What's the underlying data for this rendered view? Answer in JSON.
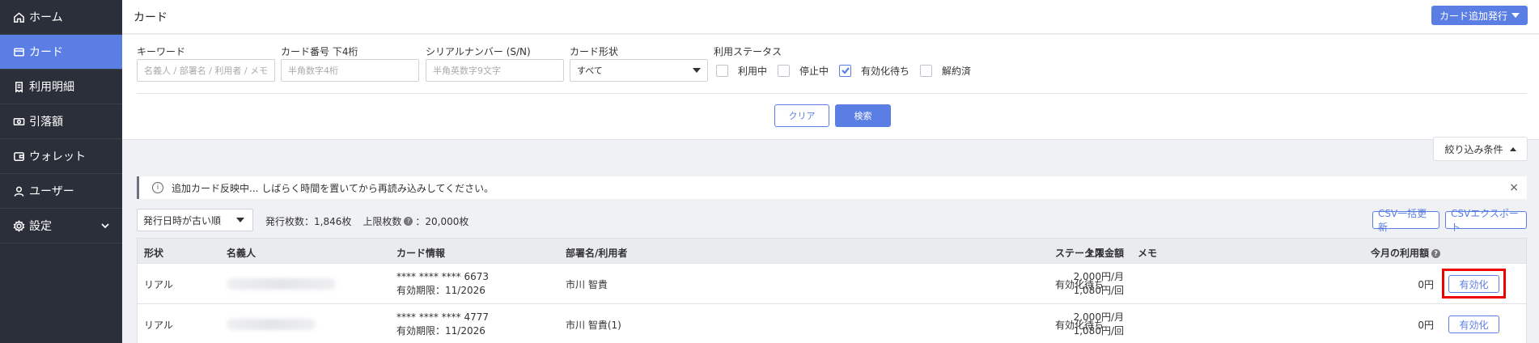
{
  "sidebar": {
    "items": [
      {
        "label": "ホーム",
        "icon": "home-icon"
      },
      {
        "label": "カード",
        "icon": "card-icon",
        "active": true
      },
      {
        "label": "利用明細",
        "icon": "receipt-icon"
      },
      {
        "label": "引落額",
        "icon": "money-icon"
      },
      {
        "label": "ウォレット",
        "icon": "wallet-icon"
      },
      {
        "label": "ユーザー",
        "icon": "user-icon"
      },
      {
        "label": "設定",
        "icon": "gear-icon"
      }
    ]
  },
  "header": {
    "title": "カード",
    "add_button": "カード追加発行"
  },
  "filters": {
    "keyword": {
      "label": "キーワード",
      "placeholder": "名義人 / 部署名 / 利用者 / メモ"
    },
    "card_last4": {
      "label": "カード番号 下4桁",
      "placeholder": "半角数字4桁"
    },
    "serial": {
      "label": "シリアルナンバー (S/N)",
      "placeholder": "半角英数字9文字"
    },
    "card_form": {
      "label": "カード形状",
      "value": "すべて"
    },
    "status": {
      "label": "利用ステータス",
      "options": [
        {
          "label": "利用中",
          "checked": false
        },
        {
          "label": "停止中",
          "checked": false
        },
        {
          "label": "有効化待ち",
          "checked": true
        },
        {
          "label": "解約済",
          "checked": false
        }
      ]
    },
    "clear_button": "クリア",
    "search_button": "検索",
    "narrow_toggle": "絞り込み条件"
  },
  "notice": {
    "text": "追加カード反映中... しばらく時間を置いてから再読み込みしてください。",
    "close": "×"
  },
  "toolbar": {
    "sort_value": "発行日時が古い順",
    "issued_count": "発行枚数：1,846枚",
    "limit_label": "上限枚数",
    "limit_value": "：20,000枚",
    "csv_update": "CSV一括更新",
    "csv_export": "CSVエクスポート"
  },
  "table": {
    "headers": {
      "form": "形状",
      "holder": "名義人",
      "card_info": "カード情報",
      "dept_user": "部署名/利用者",
      "limit": "上限金額",
      "status": "ステータス",
      "memo": "メモ",
      "usage": "今月の利用額"
    },
    "rows": [
      {
        "form": "リアル",
        "card_number": "**** **** **** 6673",
        "expiry": "有効期限：11/2026",
        "dept_user": "市川 智貴",
        "limit_month": "2,000円/月",
        "limit_once": "1,080円/回",
        "status": "有効化待ち",
        "memo": "",
        "usage": "0円",
        "action": "有効化"
      },
      {
        "form": "リアル",
        "card_number": "**** **** **** 4777",
        "expiry": "有効期限：11/2026",
        "dept_user": "市川 智貴(1)",
        "limit_month": "2,000円/月",
        "limit_once": "1,080円/回",
        "status": "有効化待ち",
        "memo": "",
        "usage": "0円",
        "action": "有効化"
      }
    ]
  },
  "colors": {
    "accent": "#5b7ee5",
    "sidebar_bg": "#2b2f3a",
    "highlight": "#ee0000"
  }
}
